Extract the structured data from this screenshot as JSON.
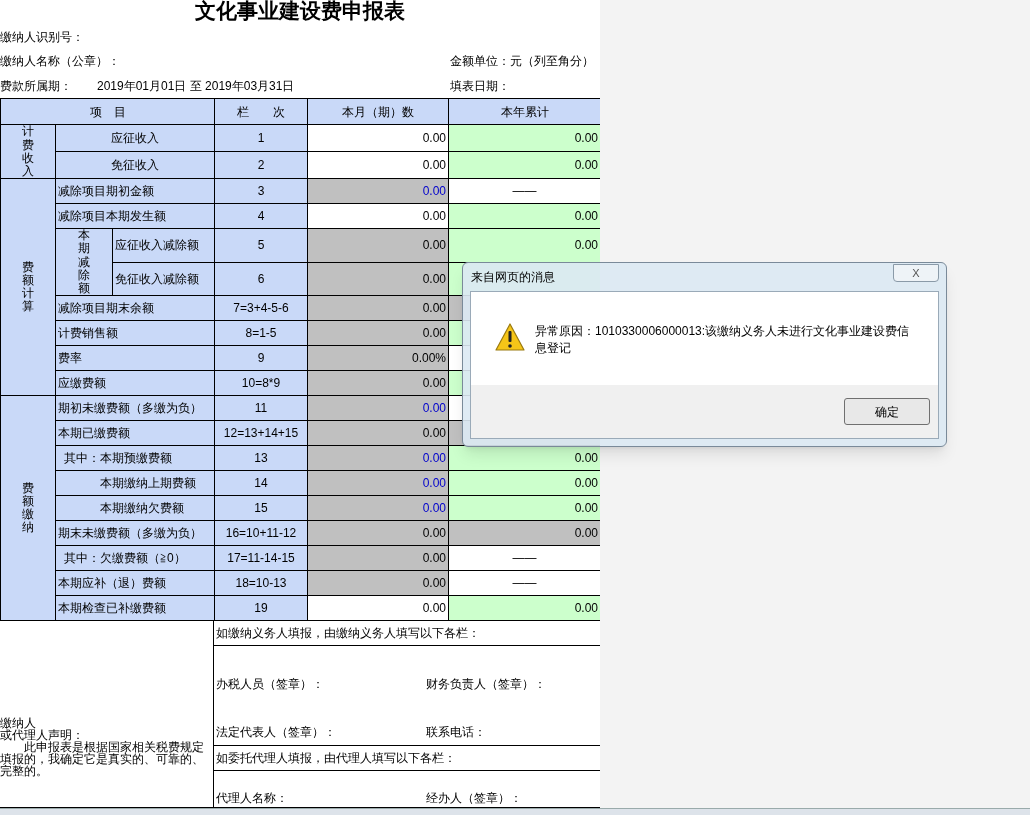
{
  "form": {
    "title": "文化事业建设费申报表",
    "fields": [
      {
        "label": "缴纳人识别号："
      },
      {
        "label": "缴纳人名称（公章）：",
        "right_label": "金额单位：元（列至角分）"
      },
      {
        "label": "费款所属期：",
        "value": "2019年01月01日 至 2019年03月31日",
        "right_label": "填表日期："
      }
    ],
    "columns": [
      "项　目",
      "栏　　次",
      "本月（期）数",
      "本年累计"
    ],
    "sections": [
      {
        "title": "计费收入",
        "rows": [
          {
            "label": "应征收入",
            "line": "1",
            "centered": true,
            "current": {
              "kind": "input",
              "text": "0.00"
            },
            "ytd": {
              "kind": "total",
              "text": "0.00"
            }
          },
          {
            "label": "免征收入",
            "line": "2",
            "centered": true,
            "current": {
              "kind": "input",
              "text": "0.00"
            },
            "ytd": {
              "kind": "total",
              "text": "0.00"
            }
          }
        ]
      },
      {
        "title": "费额计算",
        "rows": [
          {
            "label": "减除项目期初金额",
            "line": "3",
            "current": {
              "kind": "locked",
              "text": "0.00",
              "linked": true
            },
            "ytd": {
              "kind": "na",
              "text": "——"
            }
          },
          {
            "label": "减除项目本期发生额",
            "line": "4",
            "current": {
              "kind": "input",
              "text": "0.00"
            },
            "ytd": {
              "kind": "total",
              "text": "0.00"
            }
          },
          {
            "kind": "group",
            "label": "本期减除额",
            "rows": [
              {
                "label": "应征收入减除额",
                "line": "5",
                "current": {
                  "kind": "locked",
                  "text": "0.00"
                },
                "ytd": {
                  "kind": "total",
                  "text": "0.00"
                }
              },
              {
                "label": "免征收入减除额",
                "line": "6",
                "current": {
                  "kind": "locked",
                  "text": "0.00"
                },
                "ytd": {
                  "kind": "total"
                }
              }
            ]
          },
          {
            "label": "减除项目期末余额",
            "line": "7=3+4-5-6",
            "current": {
              "kind": "locked",
              "text": "0.00"
            },
            "ytd": {
              "kind": "locked"
            }
          },
          {
            "label": "计费销售额",
            "line": "8=1-5",
            "current": {
              "kind": "locked",
              "text": "0.00"
            },
            "ytd": {
              "kind": "total"
            }
          },
          {
            "label": "费率",
            "line": "9",
            "current": {
              "kind": "locked",
              "text": "0.00%"
            },
            "ytd": {
              "kind": "na"
            }
          },
          {
            "label": "应缴费额",
            "line": "10=8*9",
            "current": {
              "kind": "locked",
              "text": "0.00"
            },
            "ytd": {
              "kind": "total"
            }
          }
        ]
      },
      {
        "title": "费额缴纳",
        "rows": [
          {
            "label": "期初未缴费额（多缴为负）",
            "line": "11",
            "current": {
              "kind": "locked",
              "text": "0.00",
              "linked": true
            },
            "ytd": {
              "kind": "na"
            }
          },
          {
            "label": "本期已缴费额",
            "line": "12=13+14+15",
            "current": {
              "kind": "locked",
              "text": "0.00"
            },
            "ytd": {
              "kind": "locked"
            },
            "children": [
              {
                "label": "其中：本期预缴费额",
                "line": "13",
                "current": {
                  "kind": "locked",
                  "text": "0.00",
                  "linked": true
                },
                "ytd": {
                  "kind": "total",
                  "text": "0.00"
                }
              },
              {
                "label": "本期缴纳上期费额",
                "line": "14",
                "current": {
                  "kind": "locked",
                  "text": "0.00",
                  "linked": true
                },
                "ytd": {
                  "kind": "total",
                  "text": "0.00"
                }
              },
              {
                "label": "本期缴纳欠费额",
                "line": "15",
                "current": {
                  "kind": "locked",
                  "text": "0.00",
                  "linked": true
                },
                "ytd": {
                  "kind": "total",
                  "text": "0.00"
                }
              }
            ]
          },
          {
            "label": "期末未缴费额（多缴为负）",
            "line": "16=10+11-12",
            "current": {
              "kind": "locked",
              "text": "0.00"
            },
            "ytd": {
              "kind": "locked",
              "text": "0.00"
            },
            "children": [
              {
                "label": "其中：欠缴费额（≧0）",
                "line": "17=11-14-15",
                "current": {
                  "kind": "locked",
                  "text": "0.00"
                },
                "ytd": {
                  "kind": "na",
                  "text": "——"
                }
              }
            ]
          },
          {
            "label": "本期应补（退）费额",
            "line": "18=10-13",
            "current": {
              "kind": "locked",
              "text": "0.00"
            },
            "ytd": {
              "kind": "na",
              "text": "——"
            }
          },
          {
            "label": "本期检查已补缴费额",
            "line": "19",
            "current": {
              "kind": "input",
              "text": "0.00"
            },
            "ytd": {
              "kind": "total",
              "text": "0.00"
            }
          }
        ]
      }
    ],
    "declaration": {
      "heading": [
        "缴纳人",
        "或代理人声明："
      ],
      "body": "此申报表是根据国家相关税费规定填报的，我确定它是真实的、可靠的、完整的。"
    },
    "signature_blocks": [
      {
        "heading": "如缴纳义务人填报，由缴纳义务人填写以下各栏：",
        "lines": [
          [
            "办税人员（签章）：",
            "财务负责人（签章）："
          ],
          [
            "法定代表人（签章）：",
            "联系电话："
          ]
        ]
      },
      {
        "heading": "如委托代理人填报，由代理人填写以下各栏：",
        "lines": [
          [
            "代理人名称：",
            "经办人（签章）："
          ]
        ]
      }
    ]
  },
  "dialog": {
    "title": "来自网页的消息",
    "close": "X",
    "message": "异常原因：1010330006000013:该缴纳义务人未进行文化事业建设费信息登记",
    "button": "确定"
  }
}
